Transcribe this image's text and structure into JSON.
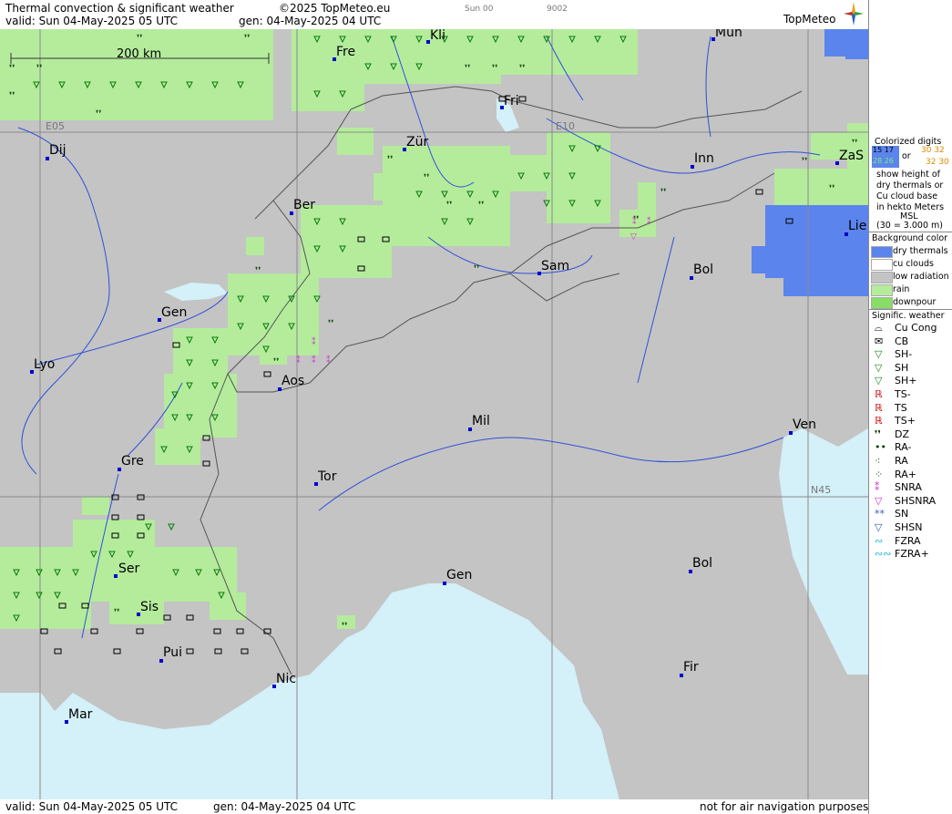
{
  "header": {
    "title": "Thermal convection & significant weather",
    "valid": "valid:  Sun  04-May-2025  05 UTC",
    "copyright": "©2025 TopMeteo.eu",
    "gen": "gen: 04-May-2025 04 UTC",
    "run": "Sun 00",
    "code": "9002",
    "brand": "TopMeteo"
  },
  "footer": {
    "valid": "valid:  Sun  04-May-2025  05 UTC",
    "gen": "gen: 04-May-2025 04 UTC",
    "disclaimer": "not for air navigation purposes"
  },
  "map": {
    "scale_label": "200 km",
    "grid_labels": {
      "e05": "E05",
      "e10": "E10",
      "n45": "N45"
    },
    "cities": [
      {
        "name": "Kli"
      },
      {
        "name": "Mün"
      },
      {
        "name": "Fre"
      },
      {
        "name": "Fri"
      },
      {
        "name": "Dij"
      },
      {
        "name": "Zür"
      },
      {
        "name": "Inn"
      },
      {
        "name": "ZaS"
      },
      {
        "name": "Ber"
      },
      {
        "name": "Lie"
      },
      {
        "name": "Sam"
      },
      {
        "name": "Bol"
      },
      {
        "name": "Gen"
      },
      {
        "name": "Lyo"
      },
      {
        "name": "Aos"
      },
      {
        "name": "Mil"
      },
      {
        "name": "Ven"
      },
      {
        "name": "Gre"
      },
      {
        "name": "Tor"
      },
      {
        "name": "Ser"
      },
      {
        "name": "Gen"
      },
      {
        "name": "Bol"
      },
      {
        "name": "Sis"
      },
      {
        "name": "Pui"
      },
      {
        "name": "Nic"
      },
      {
        "name": "Fir"
      },
      {
        "name": "Mar"
      }
    ],
    "colors": {
      "background_low_radiation": "#c4c4c4",
      "sea": "#d4f0f8",
      "rain": "#b4ec9c",
      "dry_thermals": "#5b84ec",
      "downpour": "#88dd66",
      "rivers": "#3050d8",
      "borders": "#555555",
      "city_marker": "#0000cc"
    }
  },
  "legend": {
    "colorized_title": [
      "Colorized digits"
    ],
    "sample_left": [
      "15 17",
      "28 26"
    ],
    "or": "or",
    "sample_right": [
      "30 32",
      "32 30"
    ],
    "desc": [
      "show height of",
      "dry thermals or",
      "Cu cloud base",
      "in hekto Meters",
      "MSL",
      "(30 = 3.000 m)"
    ],
    "bg_title": "Background color",
    "bg_items": [
      {
        "label": "dry thermals",
        "color": "#5b84ec"
      },
      {
        "label": "cu clouds",
        "color": "#ffffff"
      },
      {
        "label": "low radiation",
        "color": "#c4c4c4"
      },
      {
        "label": "rain",
        "color": "#b4ec9c"
      },
      {
        "label": "downpour",
        "color": "#88dd66"
      }
    ],
    "sig_title": "Signific. weather",
    "sig_items": [
      {
        "label": "Cu Cong",
        "icon": "cu-cong-icon",
        "glyph": "⌓",
        "color": "#000000"
      },
      {
        "label": "CB",
        "icon": "cb-icon",
        "glyph": "✉",
        "color": "#000000"
      },
      {
        "label": "SH-",
        "icon": "shower-light-icon",
        "glyph": "▽",
        "color": "#1a8a1a"
      },
      {
        "label": "SH",
        "icon": "shower-icon",
        "glyph": "▽",
        "color": "#1a8a1a"
      },
      {
        "label": "SH+",
        "icon": "shower-heavy-icon",
        "glyph": "▽",
        "color": "#1a8a1a"
      },
      {
        "label": "TS-",
        "icon": "thunderstorm-light-icon",
        "glyph": "ℝ",
        "color": "#cc0000"
      },
      {
        "label": "TS",
        "icon": "thunderstorm-icon",
        "glyph": "ℝ",
        "color": "#cc0000"
      },
      {
        "label": "TS+",
        "icon": "thunderstorm-heavy-icon",
        "glyph": "ℝ",
        "color": "#cc0000"
      },
      {
        "label": "DZ",
        "icon": "drizzle-icon",
        "glyph": "❜❜",
        "color": "#004400"
      },
      {
        "label": "RA-",
        "icon": "rain-light-icon",
        "glyph": "••",
        "color": "#004400"
      },
      {
        "label": "RA",
        "icon": "rain-icon",
        "glyph": "⁖",
        "color": "#004400"
      },
      {
        "label": "RA+",
        "icon": "rain-heavy-icon",
        "glyph": "⁘",
        "color": "#004400"
      },
      {
        "label": "SNRA",
        "icon": "snow-rain-icon",
        "glyph": "⁑",
        "color": "#cc33cc"
      },
      {
        "label": "SHSNRA",
        "icon": "snow-rain-shower-icon",
        "glyph": "▽",
        "color": "#cc33cc"
      },
      {
        "label": "SN",
        "icon": "snow-icon",
        "glyph": "**",
        "color": "#3355cc"
      },
      {
        "label": "SHSN",
        "icon": "snow-shower-icon",
        "glyph": "▽",
        "color": "#3355cc"
      },
      {
        "label": "FZRA",
        "icon": "freezing-rain-icon",
        "glyph": "∾",
        "color": "#22bbdd"
      },
      {
        "label": "FZRA+",
        "icon": "freezing-rain-heavy-icon",
        "glyph": "∾∾",
        "color": "#22bbdd"
      }
    ]
  }
}
